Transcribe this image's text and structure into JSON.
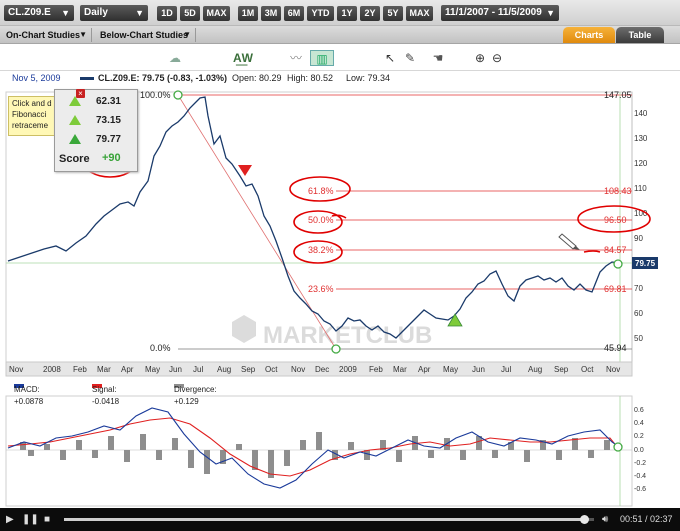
{
  "toolbar": {
    "symbol": "CL.Z09.E",
    "interval": "Daily",
    "periods": [
      "1D",
      "5D",
      "MAX",
      "1M",
      "3M",
      "6M",
      "YTD",
      "1Y",
      "2Y",
      "5Y",
      "MAX"
    ],
    "date_range": "11/1/2007 - 11/5/2009"
  },
  "studies": {
    "on_chart": "On-Chart Studies",
    "below_chart": "Below-Chart Studies"
  },
  "tabs": {
    "charts": "Charts",
    "table": "Table"
  },
  "tools": [
    "cloud-icon",
    "wave-pattern-icon",
    "line-chart-icon",
    "candlestick-icon",
    "cursor-icon",
    "draw-icon",
    "hand-icon",
    "zoom-in-icon",
    "zoom-out-icon"
  ],
  "info": {
    "date": "Nov 5, 2009",
    "quote": "CL.Z09.E: 79.75 (-0.83, -1.03%)",
    "open": "Open: 80.29",
    "high": "High: 80.52",
    "low": "Low: 79.34"
  },
  "tip": {
    "line1": "Click and d",
    "line2": "Fibonacci",
    "line3": "retraceme"
  },
  "score": {
    "rows": [
      "62.31",
      "73.15",
      "79.77"
    ],
    "label": "Score",
    "value": "+90"
  },
  "fib": {
    "pct_100": "100.0%",
    "pct_618": "61.8%",
    "pct_500": "50.0%",
    "pct_382": "38.2%",
    "pct_236": "23.6%",
    "pct_0": "0.0%",
    "val_100": "147.05",
    "val_618": "108.43",
    "val_500": "96.50",
    "val_382": "84.57",
    "val_236": "69.81",
    "val_0": "45.94"
  },
  "price_axis": [
    "140",
    "130",
    "120",
    "110",
    "100",
    "90",
    "80",
    "70",
    "60",
    "50"
  ],
  "last_price": "79.75",
  "x_axis": [
    "Nov",
    "2008",
    "Feb",
    "Mar",
    "Apr",
    "May",
    "Jun",
    "Jul",
    "Aug",
    "Sep",
    "Oct",
    "Nov",
    "Dec",
    "2009",
    "Feb",
    "Mar",
    "Apr",
    "May",
    "Jun",
    "Jul",
    "Aug",
    "Sep",
    "Oct",
    "Nov"
  ],
  "watermark": "MARKETCLUB",
  "macd": {
    "macd": "MACD: +0.0878",
    "signal": "Signal: -0.0418",
    "divergence": "Divergence: +0.129",
    "axis": [
      "0.6",
      "0.4",
      "0.2",
      "0.0",
      "-0.2",
      "-0.4",
      "-0.6"
    ]
  },
  "player": {
    "time": "00:51 / 02:37"
  },
  "colors": {
    "accent_green": "#7ecb3a",
    "fib_red": "#e03030",
    "price_line": "#1a3a6a",
    "annotation_red": "#e00000"
  }
}
